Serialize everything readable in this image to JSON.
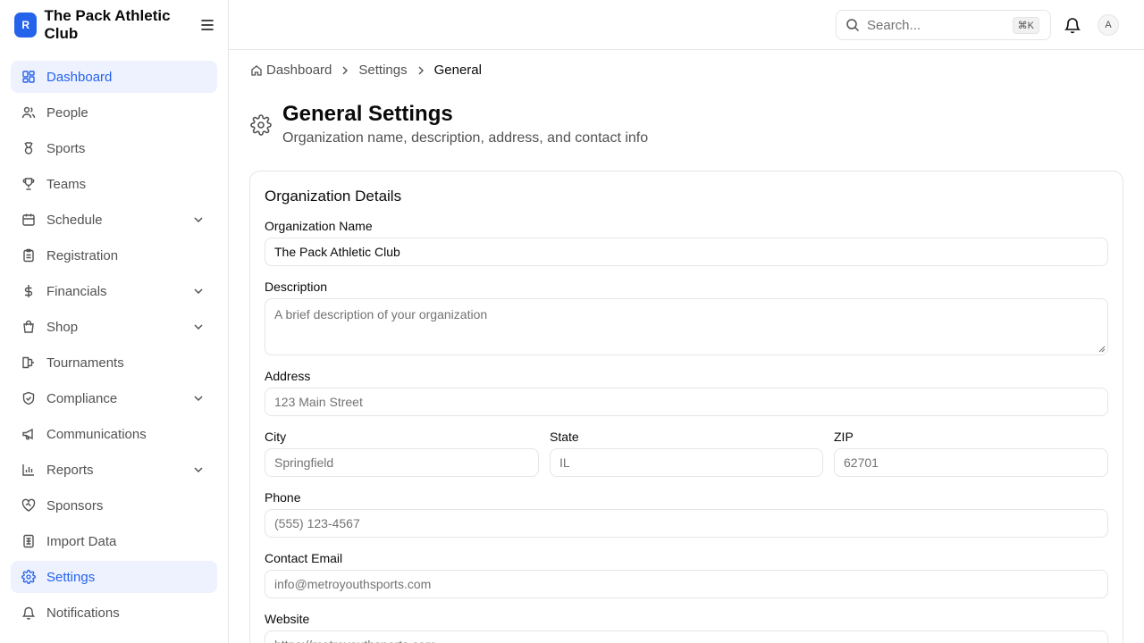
{
  "brand": {
    "logo_letter": "R",
    "name": "The Pack Athletic Club"
  },
  "sidebar": {
    "items": [
      {
        "label": "Dashboard",
        "icon": "dashboard-icon"
      },
      {
        "label": "People",
        "icon": "people-icon"
      },
      {
        "label": "Sports",
        "icon": "medal-icon"
      },
      {
        "label": "Teams",
        "icon": "trophy-icon"
      },
      {
        "label": "Schedule",
        "icon": "calendar-icon"
      },
      {
        "label": "Registration",
        "icon": "clipboard-icon"
      },
      {
        "label": "Financials",
        "icon": "dollar-icon"
      },
      {
        "label": "Shop",
        "icon": "shopping-bag-icon"
      },
      {
        "label": "Tournaments",
        "icon": "bracket-icon"
      },
      {
        "label": "Compliance",
        "icon": "shield-check-icon"
      },
      {
        "label": "Communications",
        "icon": "megaphone-icon"
      },
      {
        "label": "Reports",
        "icon": "bar-chart-icon"
      },
      {
        "label": "Sponsors",
        "icon": "handshake-heart-icon"
      },
      {
        "label": "Import Data",
        "icon": "spreadsheet-icon"
      },
      {
        "label": "Settings",
        "icon": "gear-icon"
      },
      {
        "label": "Notifications",
        "icon": "bell-icon"
      }
    ]
  },
  "topbar": {
    "search_placeholder": "Search...",
    "shortcut": "⌘K",
    "avatar_initial": "A"
  },
  "breadcrumb": {
    "home": "Dashboard",
    "parent": "Settings",
    "current": "General"
  },
  "page": {
    "title": "General Settings",
    "subtitle": "Organization name, description, address, and contact info"
  },
  "card": {
    "title": "Organization Details",
    "fields": {
      "org_name": {
        "label": "Organization Name",
        "value": "The Pack Athletic Club"
      },
      "description": {
        "label": "Description",
        "placeholder": "A brief description of your organization"
      },
      "address": {
        "label": "Address",
        "placeholder": "123 Main Street"
      },
      "city": {
        "label": "City",
        "placeholder": "Springfield"
      },
      "state": {
        "label": "State",
        "placeholder": "IL"
      },
      "zip": {
        "label": "ZIP",
        "placeholder": "62701"
      },
      "phone": {
        "label": "Phone",
        "placeholder": "(555) 123-4567"
      },
      "email": {
        "label": "Contact Email",
        "placeholder": "info@metroyouthsports.com"
      },
      "website": {
        "label": "Website",
        "placeholder": "https://metroyouthsports.com"
      }
    }
  },
  "colors": {
    "accent": "#2563eb",
    "active_bg": "#eef2ff",
    "border": "#e5e5e5",
    "muted_text": "#737373"
  }
}
